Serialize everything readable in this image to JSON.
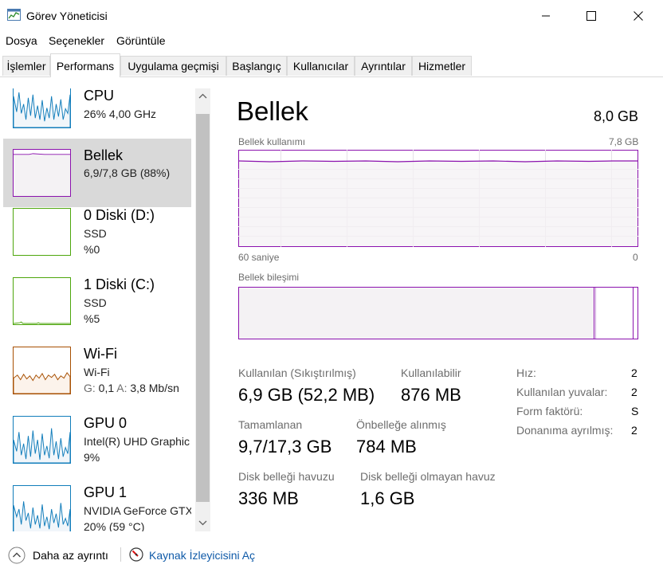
{
  "window": {
    "title": "Görev Yöneticisi"
  },
  "menu": [
    "Dosya",
    "Seçenekler",
    "Görüntüle"
  ],
  "tabs": [
    {
      "label": "İşlemler",
      "active": false
    },
    {
      "label": "Performans",
      "active": true
    },
    {
      "label": "Uygulama geçmişi",
      "active": false
    },
    {
      "label": "Başlangıç",
      "active": false
    },
    {
      "label": "Kullanıcılar",
      "active": false
    },
    {
      "label": "Ayrıntılar",
      "active": false
    },
    {
      "label": "Hizmetler",
      "active": false
    }
  ],
  "sidebar": {
    "items": [
      {
        "name": "CPU",
        "line1": "26%  4,00 GHz",
        "line2": "",
        "color": "#117dbb"
      },
      {
        "name": "Bellek",
        "line1": "6,9/7,8 GB (88%)",
        "line2": "",
        "color": "#8b12ae"
      },
      {
        "name": "0 Diski (D:)",
        "line1": "SSD",
        "line2": "%0",
        "color": "#4da60c"
      },
      {
        "name": "1 Diski (C:)",
        "line1": "SSD",
        "line2": "%5",
        "color": "#4da60c"
      },
      {
        "name": "Wi-Fi",
        "line1": "Wi-Fi",
        "line2_g": "G:",
        "line2_gv": "0,1",
        "line2_a": "A:",
        "line2_av": "3,8 Mb/sn",
        "color": "#a74f01"
      },
      {
        "name": "GPU 0",
        "line1": "Intel(R) UHD Graphic",
        "line2": "9%",
        "color": "#117dbb"
      },
      {
        "name": "GPU 1",
        "line1": "NVIDIA GeForce GTX",
        "line2": "20%  (59 °C)",
        "color": "#117dbb"
      }
    ]
  },
  "main": {
    "title": "Bellek",
    "total": "8,0 GB",
    "usage_label": "Bellek kullanımı",
    "usage_max": "7,8 GB",
    "time_left": "60 saniye",
    "time_right": "0",
    "composition_label": "Bellek bileşimi",
    "accent_color": "#8b12ae",
    "usage_fraction": 0.88,
    "stats": {
      "used_label": "Kullanılan (Sıkıştırılmış)",
      "used_value": "6,9 GB (52,2 MB)",
      "available_label": "Kullanılabilir",
      "available_value": "876 MB",
      "committed_label": "Tamamlanan",
      "committed_value": "9,7/17,3 GB",
      "cached_label": "Önbelleğe alınmış",
      "cached_value": "784 MB",
      "paged_label": "Disk belleği havuzu",
      "paged_value": "336 MB",
      "nonpaged_label": "Disk belleği olmayan havuz",
      "nonpaged_value": "1,6 GB"
    },
    "details": [
      {
        "label": "Hız:",
        "value": "2"
      },
      {
        "label": "Kullanılan yuvalar:",
        "value": "2"
      },
      {
        "label": "Form faktörü:",
        "value": "S"
      },
      {
        "label": "Donanıma ayrılmış:",
        "value": "2"
      }
    ]
  },
  "footer": {
    "fewer_details": "Daha az ayrıntı",
    "resource_monitor": "Kaynak İzleyicisini Aç"
  }
}
